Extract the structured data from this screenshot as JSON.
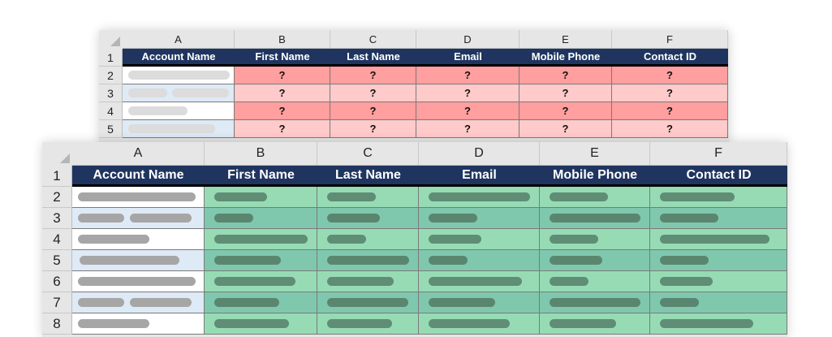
{
  "columns": [
    "A",
    "B",
    "C",
    "D",
    "E",
    "F"
  ],
  "headers": [
    "Account Name",
    "First Name",
    "Last Name",
    "Email",
    "Mobile Phone",
    "Contact ID"
  ],
  "top_sheet": {
    "rows": [
      "1",
      "2",
      "3",
      "4",
      "5"
    ],
    "unknown_value": "?",
    "colors": {
      "even": "#ff9f9f",
      "odd": "#ffcaca"
    }
  },
  "bottom_sheet": {
    "rows": [
      "1",
      "2",
      "3",
      "4",
      "5",
      "6",
      "7",
      "8"
    ],
    "colors": {
      "even": "#97dbb5",
      "odd": "#7fc8ae",
      "bar": "#5f8c73"
    }
  },
  "colors": {
    "header_bg": "#1f3560",
    "account_odd": "#deeaf6",
    "placeholder": "#a6a6a6"
  }
}
